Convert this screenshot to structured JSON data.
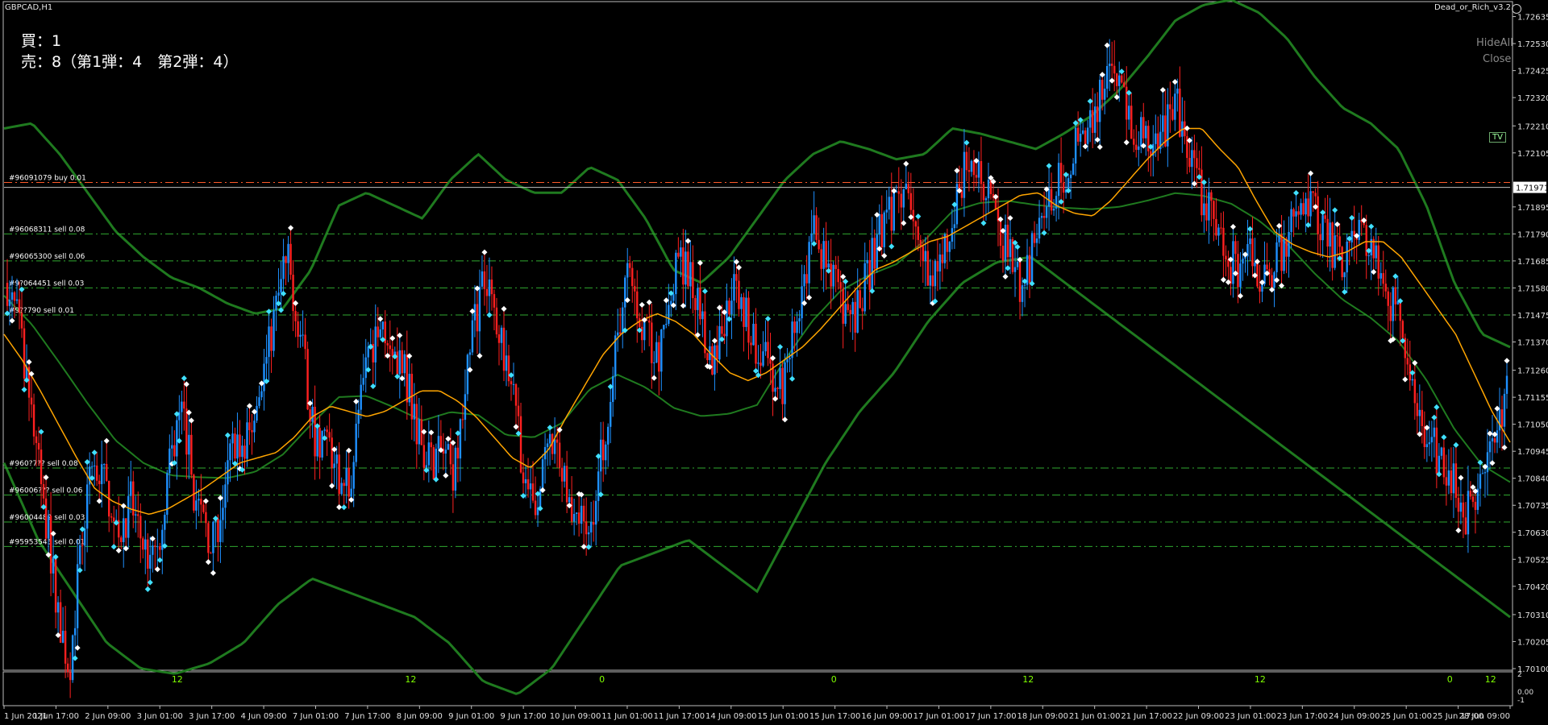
{
  "window": {
    "symbol_timeframe": "GBPCAD,H1",
    "indicator_name": "Dead_or_Rich_v3.2"
  },
  "info_box": {
    "buy_line": "買：1",
    "sell_line": "売：8（第1弾：4　第2弾：4）"
  },
  "buttons": {
    "hide_all": "HideAll",
    "close": "Close"
  },
  "tv_badge": "TV",
  "colors": {
    "background": "#000000",
    "bull_candle": "#1e90ff",
    "bear_candle": "#ff2020",
    "bollinger_band": "#1f7a1f",
    "moving_average": "#ffa500",
    "order_line": "#2fa82f",
    "buy_line": "#ff5a2a",
    "bid_line": "#c0c0c0",
    "marker_white": "#ffffff",
    "marker_cyan": "#40e0ff"
  },
  "chart_data": {
    "type": "candlestick",
    "symbol": "GBPCAD",
    "timeframe": "H1",
    "ylim": [
      1.701,
      1.7269
    ],
    "y_ticks": [
      "1.72635",
      "1.72530",
      "1.72425",
      "1.72320",
      "1.72210",
      "1.72105",
      "1.71895",
      "1.71790",
      "1.71685",
      "1.71580",
      "1.71475",
      "1.71370",
      "1.71260",
      "1.71155",
      "1.71050",
      "1.70945",
      "1.70840",
      "1.70735",
      "1.70630",
      "1.70525",
      "1.70420",
      "1.70310",
      "1.70205",
      "1.70100"
    ],
    "current_price_label": "1.71971",
    "current_price": 1.71971,
    "x_ticks": [
      "1 Jun 2021",
      "1 Jun 17:00",
      "2 Jun 09:00",
      "3 Jun 01:00",
      "3 Jun 17:00",
      "4 Jun 09:00",
      "7 Jun 01:00",
      "7 Jun 17:00",
      "8 Jun 09:00",
      "9 Jun 01:00",
      "9 Jun 17:00",
      "10 Jun 09:00",
      "11 Jun 01:00",
      "11 Jun 17:00",
      "14 Jun 09:00",
      "15 Jun 01:00",
      "15 Jun 17:00",
      "16 Jun 09:00",
      "17 Jun 01:00",
      "17 Jun 17:00",
      "18 Jun 09:00",
      "21 Jun 01:00",
      "21 Jun 17:00",
      "22 Jun 09:00",
      "23 Jun 01:00",
      "23 Jun 17:00",
      "24 Jun 09:00",
      "25 Jun 01:00",
      "25 Jun 17:00",
      "28 Jun 09:00"
    ],
    "close_path": [
      1.716,
      1.7145,
      1.712,
      1.709,
      1.706,
      1.703,
      1.701,
      1.705,
      1.709,
      1.7085,
      1.7075,
      1.7065,
      1.7075,
      1.706,
      1.705,
      1.707,
      1.7095,
      1.711,
      1.708,
      1.7065,
      1.706,
      1.708,
      1.71,
      1.7095,
      1.711,
      1.713,
      1.715,
      1.717,
      1.715,
      1.712,
      1.7095,
      1.71,
      1.7085,
      1.708,
      1.711,
      1.713,
      1.715,
      1.714,
      1.713,
      1.7115,
      1.71,
      1.709,
      1.7095,
      1.7085,
      1.711,
      1.714,
      1.716,
      1.715,
      1.7135,
      1.7125,
      1.708,
      1.707,
      1.709,
      1.7095,
      1.708,
      1.707,
      1.706,
      1.708,
      1.711,
      1.714,
      1.7165,
      1.715,
      1.714,
      1.713,
      1.715,
      1.717,
      1.716,
      1.715,
      1.713,
      1.714,
      1.716,
      1.715,
      1.714,
      1.713,
      1.7125,
      1.712,
      1.714,
      1.716,
      1.718,
      1.717,
      1.716,
      1.715,
      1.7145,
      1.716,
      1.7175,
      1.7185,
      1.719,
      1.72,
      1.718,
      1.716,
      1.7165,
      1.718,
      1.7195,
      1.721,
      1.72,
      1.719,
      1.718,
      1.717,
      1.716,
      1.717,
      1.718,
      1.7195,
      1.72,
      1.721,
      1.7215,
      1.7225,
      1.724,
      1.725,
      1.723,
      1.722,
      1.7215,
      1.721,
      1.722,
      1.723,
      1.721,
      1.72,
      1.719,
      1.718,
      1.717,
      1.7165,
      1.7175,
      1.716,
      1.7165,
      1.717,
      1.718,
      1.7185,
      1.719,
      1.718,
      1.7175,
      1.717,
      1.7175,
      1.718,
      1.717,
      1.716,
      1.715,
      1.714,
      1.712,
      1.7105,
      1.7095,
      1.709,
      1.708,
      1.707,
      1.7075,
      1.709,
      1.71,
      1.712
    ],
    "moving_average": [
      1.714,
      1.713,
      1.7118,
      1.7105,
      1.7092,
      1.708,
      1.7075,
      1.7072,
      1.707,
      1.7072,
      1.7076,
      1.708,
      1.7085,
      1.709,
      1.7092,
      1.7094,
      1.71,
      1.7108,
      1.7112,
      1.711,
      1.7108,
      1.711,
      1.7114,
      1.7118,
      1.7118,
      1.7114,
      1.7108,
      1.71,
      1.7092,
      1.7088,
      1.7095,
      1.7108,
      1.712,
      1.7132,
      1.714,
      1.7145,
      1.7148,
      1.7145,
      1.714,
      1.7132,
      1.7125,
      1.7122,
      1.7125,
      1.713,
      1.7135,
      1.7142,
      1.715,
      1.7158,
      1.7165,
      1.7168,
      1.7172,
      1.7176,
      1.7178,
      1.7182,
      1.7186,
      1.719,
      1.7194,
      1.7195,
      1.719,
      1.7187,
      1.7186,
      1.7192,
      1.72,
      1.7208,
      1.7215,
      1.722,
      1.722,
      1.7212,
      1.7205,
      1.7192,
      1.718,
      1.7175,
      1.7172,
      1.717,
      1.7172,
      1.7176,
      1.7176,
      1.717,
      1.716,
      1.715,
      1.714,
      1.7125,
      1.711,
      1.7098
    ],
    "bollinger_upper": [
      1.722,
      1.7222,
      1.721,
      1.7195,
      1.718,
      1.717,
      1.7162,
      1.7158,
      1.7152,
      1.7148,
      1.715,
      1.7165,
      1.719,
      1.7195,
      1.719,
      1.7185,
      1.72,
      1.721,
      1.72,
      1.7195,
      1.7195,
      1.7205,
      1.72,
      1.7185,
      1.7165,
      1.716,
      1.717,
      1.7185,
      1.72,
      1.721,
      1.7215,
      1.7212,
      1.7208,
      1.721,
      1.722,
      1.7218,
      1.7215,
      1.7212,
      1.7218,
      1.7225,
      1.7235,
      1.7248,
      1.7262,
      1.7268,
      1.727,
      1.7265,
      1.7255,
      1.724,
      1.7228,
      1.7222,
      1.7212,
      1.719,
      1.716,
      1.714,
      1.7135
    ],
    "bollinger_lower": [
      1.709,
      1.706,
      1.704,
      1.702,
      1.701,
      1.7008,
      1.7012,
      1.702,
      1.7035,
      1.7045,
      1.704,
      1.7035,
      1.703,
      1.702,
      1.7005,
      1.7,
      1.701,
      1.703,
      1.705,
      1.7055,
      1.706,
      1.705,
      1.704,
      1.7065,
      1.709,
      1.711,
      1.7125,
      1.7145,
      1.716,
      1.7168,
      1.717,
      1.716,
      1.715,
      1.714,
      1.713,
      1.712,
      1.711,
      1.71,
      1.709,
      1.708,
      1.707,
      1.706,
      1.705,
      1.704,
      1.703
    ],
    "order_lines": [
      {
        "label": "#96091079 buy 0.01",
        "price": 1.7199,
        "kind": "buy"
      },
      {
        "label": "#96068311 sell 0.08",
        "price": 1.7179,
        "kind": "sell"
      },
      {
        "label": "#96065300 sell 0.06",
        "price": 1.71685,
        "kind": "sell"
      },
      {
        "label": "#9?064451 sell 0.03",
        "price": 1.7158,
        "kind": "sell"
      },
      {
        "label": "#9??790 sell 0.01",
        "price": 1.71475,
        "kind": "sell"
      },
      {
        "label": "#960?7?? sell 0.08",
        "price": 1.7088,
        "kind": "sell"
      },
      {
        "label": "#96006??? sell 0.06",
        "price": 1.70775,
        "kind": "sell"
      },
      {
        "label": "#96004482 sell 0.03",
        "price": 1.7067,
        "kind": "sell"
      },
      {
        "label": "#95953545 sell 0.01",
        "price": 1.70575,
        "kind": "sell"
      }
    ],
    "sub_panel": {
      "y_ticks": [
        "2",
        "0.00",
        "-1"
      ],
      "hour_labels": [
        {
          "text": "12",
          "x_frac": 0.115
        },
        {
          "text": "12",
          "x_frac": 0.27
        },
        {
          "text": "0",
          "x_frac": 0.397
        },
        {
          "text": "0",
          "x_frac": 0.551
        },
        {
          "text": "12",
          "x_frac": 0.68
        },
        {
          "text": "12",
          "x_frac": 0.834
        },
        {
          "text": "0",
          "x_frac": 0.96
        },
        {
          "text": "12",
          "x_frac": 0.987
        }
      ]
    }
  }
}
